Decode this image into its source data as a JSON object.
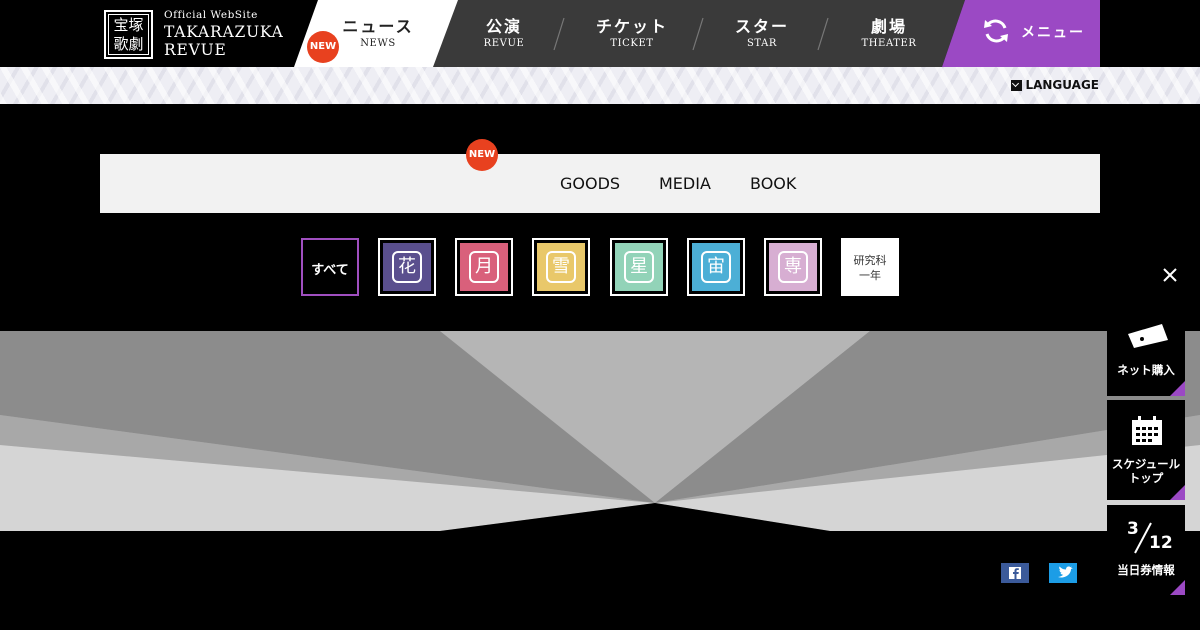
{
  "header": {
    "logo": {
      "seal_line1": "宝塚",
      "seal_line2": "歌劇",
      "subtitle": "Official WebSite",
      "name_line1": "TAKARAZUKA",
      "name_line2": "REVUE"
    },
    "nav": [
      {
        "jp": "ニュース",
        "en": "NEWS",
        "active": true,
        "badge": "NEW"
      },
      {
        "jp": "公演",
        "en": "REVUE"
      },
      {
        "jp": "チケット",
        "en": "TICKET"
      },
      {
        "jp": "スター",
        "en": "STAR"
      },
      {
        "jp": "劇場",
        "en": "THEATER"
      }
    ],
    "menu_label": "メニュー",
    "colors": {
      "nav_dark": "#3a3a3a",
      "nav_active": "#ffffff",
      "menu_purple": "#9b49c4",
      "badge_red": "#e8411f"
    }
  },
  "language_label": "LANGUAGE",
  "category_tabs": [
    {
      "label": "GOODS"
    },
    {
      "label": "MEDIA"
    },
    {
      "label": "BOOK"
    }
  ],
  "category_badge": "NEW",
  "troupes": [
    {
      "label": "すべて",
      "selected": true,
      "color": "#000000"
    },
    {
      "glyph": "花",
      "color": "#5a4f8e",
      "icon": "flower-troupe-seal"
    },
    {
      "glyph": "月",
      "color": "#d9607b",
      "icon": "moon-troupe-seal"
    },
    {
      "glyph": "雪",
      "color": "#e9c86a",
      "icon": "snow-troupe-seal"
    },
    {
      "glyph": "星",
      "color": "#92d3b8",
      "icon": "star-troupe-seal"
    },
    {
      "glyph": "宙",
      "color": "#4cafd6",
      "icon": "cosmos-troupe-seal"
    },
    {
      "glyph": "専",
      "color": "#d7aed2",
      "icon": "senka-seal"
    },
    {
      "label": "研究科\n一年",
      "color": "#ffffff"
    }
  ],
  "side_buttons": {
    "net_purchase": "ネット購入",
    "schedule": "スケジュール\nトップ",
    "today_month": "3",
    "today_day": "12",
    "today_label": "当日券情報"
  }
}
